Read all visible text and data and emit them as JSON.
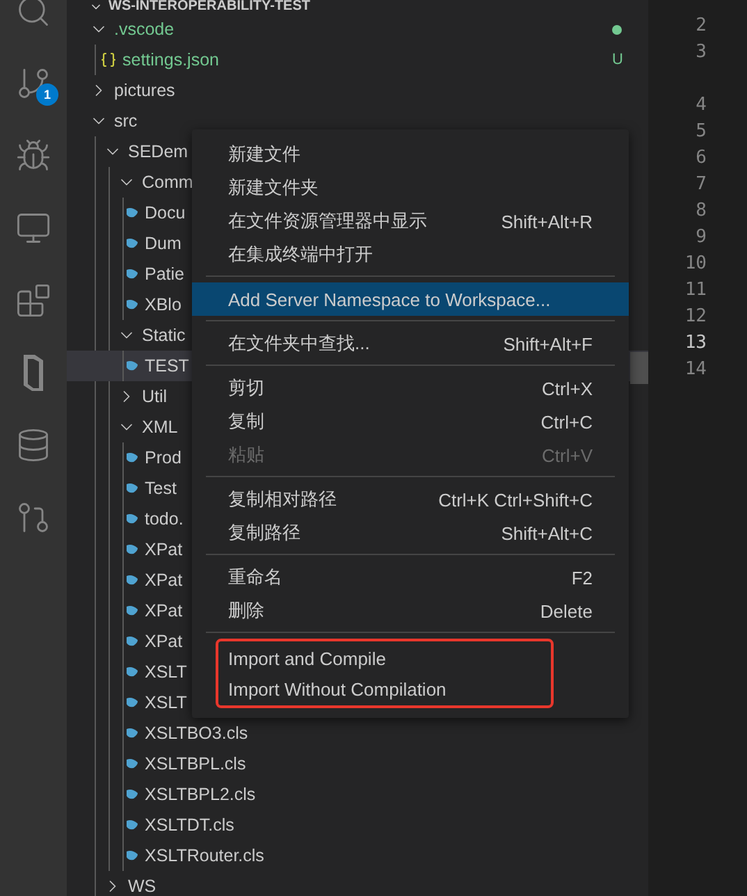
{
  "activity_bar": {
    "items": [
      {
        "kind": "search"
      },
      {
        "kind": "source-control",
        "badge": "1"
      },
      {
        "kind": "debug"
      },
      {
        "kind": "remote"
      },
      {
        "kind": "extensions"
      },
      {
        "kind": "slab"
      },
      {
        "kind": "database"
      },
      {
        "kind": "pull-request"
      }
    ]
  },
  "explorer": {
    "title": "WS-INTEROPERABILITY-TEST",
    "tree": [
      {
        "name": ".vscode",
        "kind": "folder",
        "expanded": true,
        "untracked": true,
        "status_dot": true,
        "children": [
          {
            "name": "settings.json",
            "kind": "json",
            "untracked": true,
            "decoration": "U"
          }
        ]
      },
      {
        "name": "pictures",
        "kind": "folder",
        "expanded": false
      },
      {
        "name": "src",
        "kind": "folder",
        "expanded": true,
        "children": [
          {
            "name": "SEDem",
            "kind": "folder",
            "expanded": true,
            "children": [
              {
                "name": "Comm",
                "kind": "folder",
                "expanded": true,
                "children": [
                  {
                    "name": "Docu",
                    "kind": "cls"
                  },
                  {
                    "name": "Dum",
                    "kind": "cls"
                  },
                  {
                    "name": "Patie",
                    "kind": "cls"
                  },
                  {
                    "name": "XBlo",
                    "kind": "cls"
                  }
                ]
              },
              {
                "name": "Static",
                "kind": "folder",
                "expanded": true,
                "children": [
                  {
                    "name": "TEST",
                    "kind": "cls",
                    "selected": true
                  }
                ]
              },
              {
                "name": "Util",
                "kind": "folder",
                "expanded": false
              },
              {
                "name": "XML",
                "kind": "folder",
                "expanded": true,
                "children": [
                  {
                    "name": "Prod",
                    "kind": "cls"
                  },
                  {
                    "name": "Test",
                    "kind": "cls"
                  },
                  {
                    "name": "todo.",
                    "kind": "cls"
                  },
                  {
                    "name": "XPat",
                    "kind": "cls"
                  },
                  {
                    "name": "XPat",
                    "kind": "cls"
                  },
                  {
                    "name": "XPat",
                    "kind": "cls"
                  },
                  {
                    "name": "XPat",
                    "kind": "cls"
                  },
                  {
                    "name": "XSLT",
                    "kind": "cls"
                  },
                  {
                    "name": "XSLT",
                    "kind": "cls"
                  },
                  {
                    "name": "XSLTBO3.cls",
                    "kind": "cls"
                  },
                  {
                    "name": "XSLTBPL.cls",
                    "kind": "cls"
                  },
                  {
                    "name": "XSLTBPL2.cls",
                    "kind": "cls"
                  },
                  {
                    "name": "XSLTDT.cls",
                    "kind": "cls"
                  },
                  {
                    "name": "XSLTRouter.cls",
                    "kind": "cls"
                  }
                ]
              }
            ]
          },
          {
            "name": "WS",
            "kind": "folder",
            "expanded": false
          }
        ]
      }
    ]
  },
  "context_menu": {
    "groups": [
      {
        "outlined": false,
        "items": [
          {
            "label": "新建文件",
            "disabled": false,
            "selected": false
          },
          {
            "label": "新建文件夹",
            "disabled": false,
            "selected": false
          },
          {
            "label": "在文件资源管理器中显示",
            "shortcut": "Shift+Alt+R",
            "disabled": false,
            "selected": false
          },
          {
            "label": "在集成终端中打开",
            "disabled": false,
            "selected": false
          }
        ]
      },
      {
        "outlined": false,
        "items": [
          {
            "label": "Add Server Namespace to Workspace...",
            "disabled": false,
            "selected": true
          }
        ]
      },
      {
        "outlined": false,
        "items": [
          {
            "label": "在文件夹中查找...",
            "shortcut": "Shift+Alt+F",
            "disabled": false,
            "selected": false
          }
        ]
      },
      {
        "outlined": false,
        "items": [
          {
            "label": "剪切",
            "shortcut": "Ctrl+X",
            "disabled": false,
            "selected": false
          },
          {
            "label": "复制",
            "shortcut": "Ctrl+C",
            "disabled": false,
            "selected": false
          },
          {
            "label": "粘贴",
            "shortcut": "Ctrl+V",
            "disabled": true,
            "selected": false
          }
        ]
      },
      {
        "outlined": false,
        "items": [
          {
            "label": "复制相对路径",
            "shortcut": "Ctrl+K Ctrl+Shift+C",
            "disabled": false,
            "selected": false
          },
          {
            "label": "复制路径",
            "shortcut": "Shift+Alt+C",
            "disabled": false,
            "selected": false
          }
        ]
      },
      {
        "outlined": false,
        "items": [
          {
            "label": "重命名",
            "shortcut": "F2",
            "disabled": false,
            "selected": false
          },
          {
            "label": "删除",
            "shortcut": "Delete",
            "disabled": false,
            "selected": false
          }
        ]
      },
      {
        "outlined": true,
        "items": [
          {
            "label": "Import and Compile",
            "disabled": false,
            "selected": false
          },
          {
            "label": "Import Without Compilation",
            "disabled": false,
            "selected": false
          }
        ]
      }
    ]
  },
  "editor": {
    "lines": [
      {
        "number": "2",
        "current": false,
        "gap_before": false
      },
      {
        "number": "3",
        "current": false,
        "gap_before": false
      },
      {
        "number": "4",
        "current": false,
        "gap_before": true
      },
      {
        "number": "5",
        "current": false,
        "gap_before": false
      },
      {
        "number": "6",
        "current": false,
        "gap_before": false
      },
      {
        "number": "7",
        "current": false,
        "gap_before": false
      },
      {
        "number": "8",
        "current": false,
        "gap_before": false
      },
      {
        "number": "9",
        "current": false,
        "gap_before": false
      },
      {
        "number": "10",
        "current": false,
        "gap_before": false
      },
      {
        "number": "11",
        "current": false,
        "gap_before": false
      },
      {
        "number": "12",
        "current": false,
        "gap_before": false
      },
      {
        "number": "13",
        "current": true,
        "gap_before": false
      },
      {
        "number": "14",
        "current": false,
        "gap_before": false
      }
    ]
  }
}
